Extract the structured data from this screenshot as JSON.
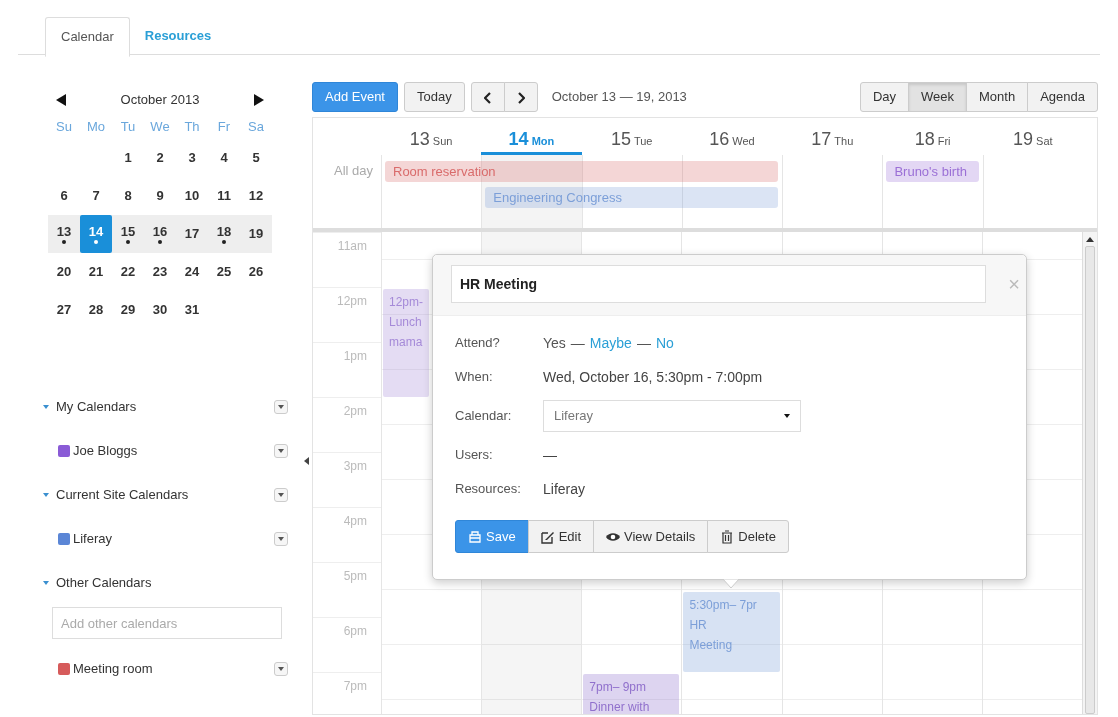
{
  "tabs": [
    {
      "label": "Calendar",
      "selected": true
    },
    {
      "label": "Resources",
      "selected": false
    }
  ],
  "mini_calendar": {
    "title": "October 2013",
    "weekdays": [
      "Su",
      "Mo",
      "Tu",
      "We",
      "Th",
      "Fr",
      "Sa"
    ],
    "weeks": [
      {
        "highlighted": false,
        "days": [
          {
            "label": "1",
            "has_events": false,
            "selected": false
          },
          {
            "label": "2",
            "has_events": false,
            "selected": false
          },
          {
            "label": "3",
            "has_events": false,
            "selected": false
          },
          {
            "label": "4",
            "has_events": false,
            "selected": false
          },
          {
            "label": "5",
            "has_events": false,
            "selected": false
          }
        ]
      },
      {
        "highlighted": false,
        "days": [
          {
            "label": "6",
            "has_events": false,
            "selected": false
          },
          {
            "label": "7",
            "has_events": false,
            "selected": false
          },
          {
            "label": "8",
            "has_events": false,
            "selected": false
          },
          {
            "label": "9",
            "has_events": false,
            "selected": false
          },
          {
            "label": "10",
            "has_events": false,
            "selected": false
          },
          {
            "label": "11",
            "has_events": false,
            "selected": false
          },
          {
            "label": "12",
            "has_events": false,
            "selected": false
          }
        ]
      },
      {
        "highlighted": true,
        "days": [
          {
            "label": "13",
            "has_events": true,
            "selected": false
          },
          {
            "label": "14",
            "has_events": true,
            "selected": true
          },
          {
            "label": "15",
            "has_events": true,
            "selected": false
          },
          {
            "label": "16",
            "has_events": true,
            "selected": false
          },
          {
            "label": "17",
            "has_events": false,
            "selected": false
          },
          {
            "label": "18",
            "has_events": true,
            "selected": false
          },
          {
            "label": "19",
            "has_events": false,
            "selected": false
          }
        ]
      },
      {
        "highlighted": false,
        "days": [
          {
            "label": "20",
            "has_events": false,
            "selected": false
          },
          {
            "label": "21",
            "has_events": false,
            "selected": false
          },
          {
            "label": "22",
            "has_events": false,
            "selected": false
          },
          {
            "label": "23",
            "has_events": false,
            "selected": false
          },
          {
            "label": "24",
            "has_events": false,
            "selected": false
          },
          {
            "label": "25",
            "has_events": false,
            "selected": false
          },
          {
            "label": "26",
            "has_events": false,
            "selected": false
          }
        ]
      },
      {
        "highlighted": false,
        "days": [
          {
            "label": "27",
            "has_events": false,
            "selected": false
          },
          {
            "label": "28",
            "has_events": false,
            "selected": false
          },
          {
            "label": "29",
            "has_events": false,
            "selected": false
          },
          {
            "label": "30",
            "has_events": false,
            "selected": false
          },
          {
            "label": "31",
            "has_events": false,
            "selected": false
          }
        ]
      }
    ]
  },
  "sidebar": {
    "sections": [
      {
        "title": "My Calendars",
        "expanded": true,
        "has_options": true,
        "calendars": [
          {
            "name": "Joe Bloggs",
            "color": "#8a5bd6"
          }
        ]
      },
      {
        "title": "Current Site Calendars",
        "expanded": true,
        "has_options": true,
        "calendars": [
          {
            "name": "Liferay",
            "color": "#5b86d6"
          }
        ]
      },
      {
        "title": "Other Calendars",
        "expanded": true,
        "has_options": false,
        "search_placeholder": "Add other calendars",
        "calendars": [
          {
            "name": "Meeting room",
            "color": "#d65b5b"
          }
        ]
      }
    ]
  },
  "toolbar": {
    "add_event": "Add Event",
    "today": "Today",
    "range": "October 13 — 19, 2013",
    "views": [
      {
        "label": "Day",
        "selected": false
      },
      {
        "label": "Week",
        "selected": true
      },
      {
        "label": "Month",
        "selected": false
      },
      {
        "label": "Agenda",
        "selected": false
      }
    ]
  },
  "week": {
    "all_day_label": "All day",
    "days": [
      {
        "number": "13",
        "name": "Sun",
        "selected": false
      },
      {
        "number": "14",
        "name": "Mon",
        "selected": true
      },
      {
        "number": "15",
        "name": "Tue",
        "selected": false
      },
      {
        "number": "16",
        "name": "Wed",
        "selected": false
      },
      {
        "number": "17",
        "name": "Thu",
        "selected": false
      },
      {
        "number": "18",
        "name": "Fri",
        "selected": false
      },
      {
        "number": "19",
        "name": "Sat",
        "selected": false
      }
    ],
    "all_day_events": [
      {
        "title": "Room reservation",
        "color": "#d96b6b"
      },
      {
        "title": "Engineering Congress",
        "color": "#7c9fd8"
      },
      {
        "title": "Bruno's birth",
        "color": "#9b6fd6"
      }
    ],
    "hours": [
      "11am",
      "12pm",
      "1pm",
      "2pm",
      "3pm",
      "4pm",
      "5pm",
      "6pm",
      "7pm"
    ],
    "events": [
      {
        "lines": [
          "12pm-",
          "Lunch",
          "mama"
        ],
        "color": "#a58ad8"
      },
      {
        "lines": [
          "5:30pm– 7pr",
          "HR",
          "Meeting"
        ],
        "color": "#7c9fd8"
      },
      {
        "lines": [
          "7pm– 9pm",
          "Dinner with"
        ],
        "color": "#9070cc"
      }
    ]
  },
  "popover": {
    "title": "HR Meeting",
    "close": "×",
    "separator": "—",
    "fields": [
      {
        "kind": "attend",
        "label": "Attend?",
        "options": [
          {
            "label": "Yes",
            "selected": true
          },
          {
            "label": "Maybe",
            "selected": false
          },
          {
            "label": "No",
            "selected": false
          }
        ]
      },
      {
        "kind": "text",
        "label": "When:",
        "value": "Wed, October 16, 5:30pm - 7:00pm"
      },
      {
        "kind": "select",
        "label": "Calendar:",
        "value": "Liferay"
      },
      {
        "kind": "text",
        "label": "Users:",
        "value": "—"
      },
      {
        "kind": "text",
        "label": "Resources:",
        "value": "Liferay"
      }
    ],
    "buttons": [
      {
        "label": "Save",
        "kind": "save"
      },
      {
        "label": "Edit",
        "kind": "edit"
      },
      {
        "label": "View Details",
        "kind": "view"
      },
      {
        "label": "Delete",
        "kind": "delete"
      }
    ]
  }
}
